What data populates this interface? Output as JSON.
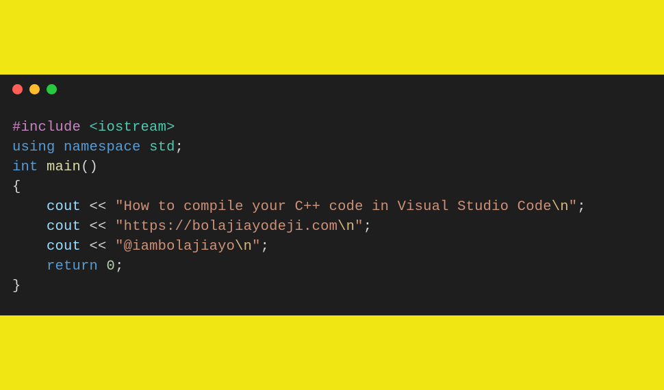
{
  "code": {
    "line1": {
      "directive": "#include",
      "space": " ",
      "arg": "<iostream>"
    },
    "line2": {
      "kw1": "using",
      "sp1": " ",
      "kw2": "namespace",
      "sp2": " ",
      "ns": "std",
      "semi": ";"
    },
    "line3": {
      "type": "int",
      "sp": " ",
      "fn": "main",
      "parens": "()"
    },
    "line4": {
      "brace": "{"
    },
    "line5": {
      "indent": "    ",
      "obj": "cout",
      "sp1": " ",
      "op": "<<",
      "sp2": " ",
      "str_open": "\"",
      "str_body": "How to compile your C++ code in Visual Studio Code",
      "esc": "\\n",
      "str_close": "\"",
      "semi": ";"
    },
    "line6": {
      "indent": "    ",
      "obj": "cout",
      "sp1": " ",
      "op": "<<",
      "sp2": " ",
      "str_open": "\"",
      "str_body": "https://bolajiayodeji.com",
      "esc": "\\n",
      "str_close": "\"",
      "semi": ";"
    },
    "line7": {
      "indent": "    ",
      "obj": "cout",
      "sp1": " ",
      "op": "<<",
      "sp2": " ",
      "str_open": "\"",
      "str_body": "@iambolajiayo",
      "esc": "\\n",
      "str_close": "\"",
      "semi": ";"
    },
    "line8": {
      "indent": "    ",
      "kw": "return",
      "sp": " ",
      "num": "0",
      "semi": ";"
    },
    "line9": {
      "brace": "}"
    }
  }
}
